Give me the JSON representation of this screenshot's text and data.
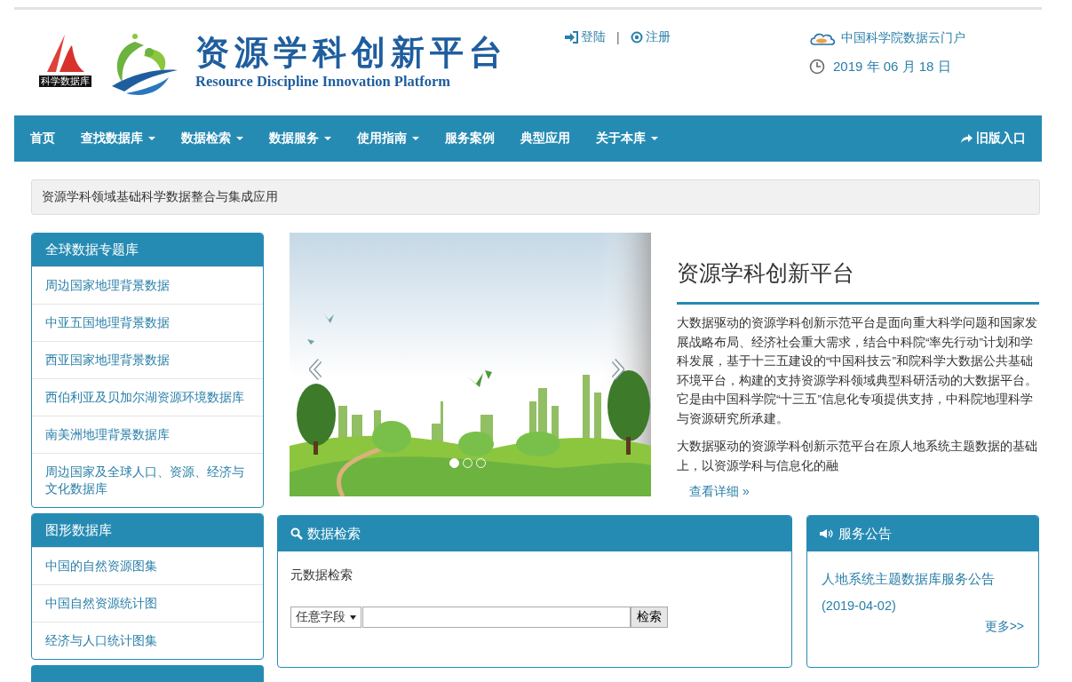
{
  "header": {
    "logo_label": "科学数据库",
    "title": "资源学科创新平台",
    "subtitle": "Resource Discipline Innovation Platform",
    "account_links": [
      {
        "kind": "login",
        "label": "登陆"
      },
      {
        "kind": "register",
        "label": "注册"
      }
    ],
    "separator": "|",
    "portal_link": "中国科学院数据云门户",
    "date": "2019 年 06 月 18 日"
  },
  "nav": {
    "items": [
      {
        "label": "首页",
        "dropdown": false
      },
      {
        "label": "查找数据库",
        "dropdown": true
      },
      {
        "label": "数据检索",
        "dropdown": true
      },
      {
        "label": "数据服务",
        "dropdown": true
      },
      {
        "label": "使用指南",
        "dropdown": true
      },
      {
        "label": "服务案例",
        "dropdown": false
      },
      {
        "label": "典型应用",
        "dropdown": false
      },
      {
        "label": "关于本库",
        "dropdown": true
      }
    ],
    "legacy_link": "旧版入口"
  },
  "breadcrumb": "资源学科领域基础科学数据整合与集成应用",
  "sidebar": {
    "panels": [
      {
        "title": "全球数据专题库",
        "items": [
          "周边国家地理背景数据",
          "中亚五国地理背景数据",
          "西亚国家地理背景数据",
          "西伯利亚及贝加尔湖资源环境数据库",
          "南美洲地理背景数据库",
          "周边国家及全球人口、资源、经济与文化数据库"
        ]
      },
      {
        "title": "图形数据库",
        "items": [
          "中国的自然资源图集",
          "中国自然资源统计图",
          "经济与人口统计图集"
        ]
      }
    ]
  },
  "carousel": {
    "indicators": [
      {
        "selected": true
      },
      {
        "selected": false
      },
      {
        "selected": false
      }
    ]
  },
  "intro": {
    "title": "资源学科创新平台",
    "paragraphs": [
      "大数据驱动的资源学科创新示范平台是面向重大科学问题和国家发展战略布局、经济社会重大需求，结合中科院“率先行动”计划和学科发展，基于十三五建设的“中国科技云”和院科学大数据公共基础环境平台，构建的支持资源学科领域典型科研活动的大数据平台。它是由中国科学院“十三五”信息化专项提供支持，中科院地理科学与资源研究所承建。",
      "大数据驱动的资源学科创新示范平台在原人地系统主题数据的基础上，以资源学科与信息化的融"
    ],
    "more_link": "查看详细 »"
  },
  "search_panel": {
    "title": "数据检索",
    "subtitle": "元数据检索",
    "field_select": "任意字段",
    "button": "检索"
  },
  "notice_panel": {
    "title": "服务公告",
    "items": [
      "人地系统主题数据库服务公告(2019-04-02)"
    ],
    "more_link": "更多>>"
  }
}
